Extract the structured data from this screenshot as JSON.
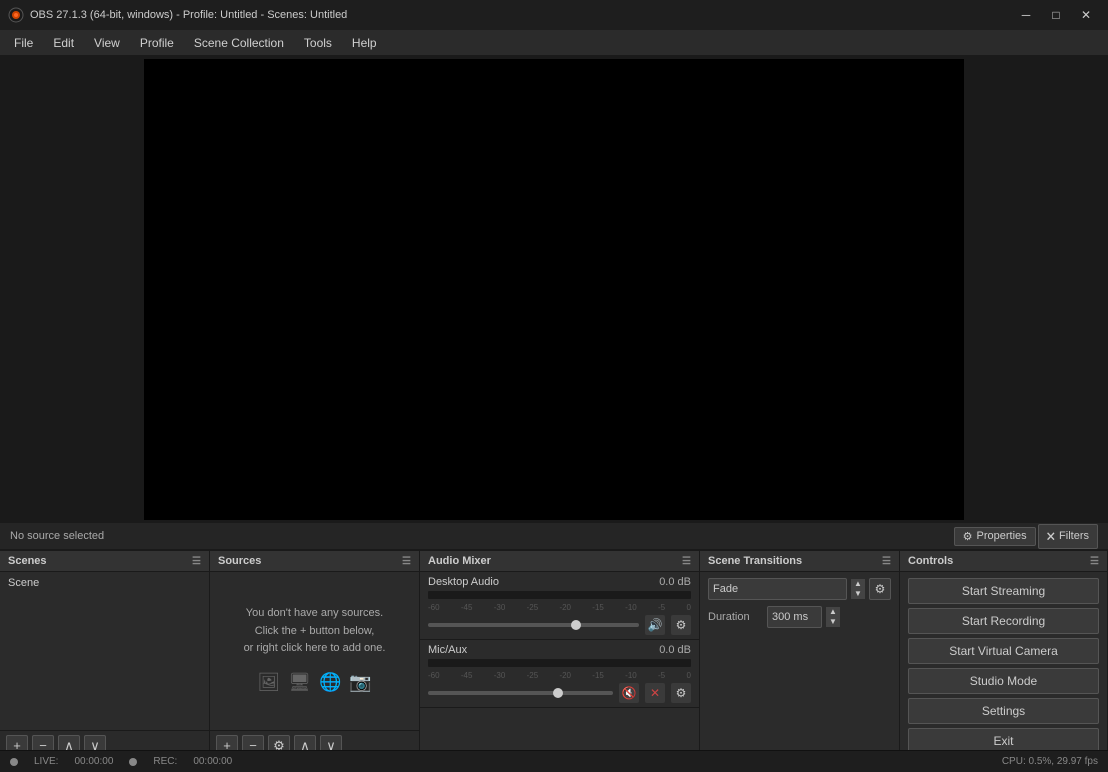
{
  "titlebar": {
    "title": "OBS 27.1.3 (64-bit, windows) - Profile: Untitled - Scenes: Untitled",
    "logo_label": "OBS",
    "btn_minimize": "─",
    "btn_maximize": "□",
    "btn_close": "✕"
  },
  "menubar": {
    "items": [
      {
        "label": "File",
        "id": "file"
      },
      {
        "label": "Edit",
        "id": "edit"
      },
      {
        "label": "View",
        "id": "view"
      },
      {
        "label": "Profile",
        "id": "profile"
      },
      {
        "label": "Scene Collection",
        "id": "scene-collection"
      },
      {
        "label": "Tools",
        "id": "tools"
      },
      {
        "label": "Help",
        "id": "help"
      }
    ]
  },
  "no_source": "No source selected",
  "properties_btn": "Properties",
  "filters_btn": "Filters",
  "panels": {
    "scenes": {
      "header": "Scenes",
      "items": [
        {
          "label": "Scene"
        }
      ]
    },
    "sources": {
      "header": "Sources",
      "empty_line1": "You don't have any sources.",
      "empty_line2": "Click the + button below,",
      "empty_line3": "or right click here to add one."
    },
    "audio_mixer": {
      "header": "Audio Mixer",
      "tracks": [
        {
          "name": "Desktop Audio",
          "db": "0.0 dB",
          "meter_pct": 0,
          "scale": [
            "-60",
            "-45",
            "-30",
            "-25",
            "-20",
            "-15",
            "-10",
            "-5",
            "0"
          ],
          "muted": false,
          "volume_pct": 70
        },
        {
          "name": "Mic/Aux",
          "db": "0.0 dB",
          "meter_pct": 0,
          "scale": [
            "-60",
            "-45",
            "-30",
            "-25",
            "-20",
            "-15",
            "-10",
            "-5",
            "0"
          ],
          "muted": true,
          "volume_pct": 70
        }
      ]
    },
    "scene_transitions": {
      "header": "Scene Transitions",
      "transition_value": "Fade",
      "duration_label": "Duration",
      "duration_value": "300 ms"
    },
    "controls": {
      "header": "Controls",
      "buttons": [
        {
          "label": "Start Streaming",
          "id": "start-streaming",
          "style": "normal"
        },
        {
          "label": "Start Recording",
          "id": "start-recording",
          "style": "normal"
        },
        {
          "label": "Start Virtual Camera",
          "id": "start-virtual-camera",
          "style": "normal"
        },
        {
          "label": "Studio Mode",
          "id": "studio-mode",
          "style": "normal"
        },
        {
          "label": "Settings",
          "id": "settings",
          "style": "normal"
        },
        {
          "label": "Exit",
          "id": "exit",
          "style": "normal"
        }
      ]
    }
  },
  "statusbar": {
    "live_label": "LIVE:",
    "live_time": "00:00:00",
    "rec_label": "REC:",
    "rec_time": "00:00:00",
    "cpu_label": "CPU: 0.5%, 29.97 fps"
  },
  "toolbar": {
    "add": "+",
    "remove": "−",
    "up": "∧",
    "down": "∨"
  }
}
